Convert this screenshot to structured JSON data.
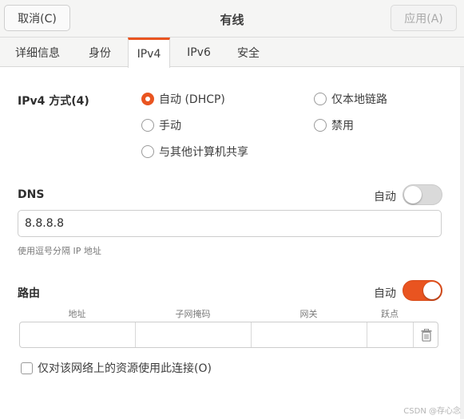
{
  "header": {
    "cancel_label": "取消(C)",
    "title": "有线",
    "apply_label": "应用(A)"
  },
  "tabs": [
    {
      "label": "详细信息"
    },
    {
      "label": "身份"
    },
    {
      "label": "IPv4",
      "active": true
    },
    {
      "label": "IPv6"
    },
    {
      "label": "安全"
    }
  ],
  "ipv4": {
    "method_label": "IPv4 方式(4)",
    "options": {
      "auto_dhcp": {
        "label": "自动 (DHCP)",
        "checked": true
      },
      "link_local": {
        "label": "仅本地链路",
        "checked": false
      },
      "manual": {
        "label": "手动",
        "checked": false
      },
      "disabled": {
        "label": "禁用",
        "checked": false
      },
      "shared": {
        "label": "与其他计算机共享",
        "checked": false
      }
    }
  },
  "dns": {
    "label": "DNS",
    "auto_label": "自动",
    "auto_enabled": false,
    "value": "8.8.8.8",
    "hint": "使用逗号分隔 IP 地址"
  },
  "routes": {
    "label": "路由",
    "auto_label": "自动",
    "auto_enabled": true,
    "columns": [
      "地址",
      "子网掩码",
      "网关",
      "跃点"
    ],
    "row": {
      "address": "",
      "netmask": "",
      "gateway": "",
      "metric": ""
    }
  },
  "only_local_resources": {
    "label": "仅对该网络上的资源使用此连接(O)",
    "checked": false
  },
  "watermark": "CSDN @存心念",
  "colors": {
    "accent": "#e95420",
    "header_bg": "#f5f5f4"
  }
}
